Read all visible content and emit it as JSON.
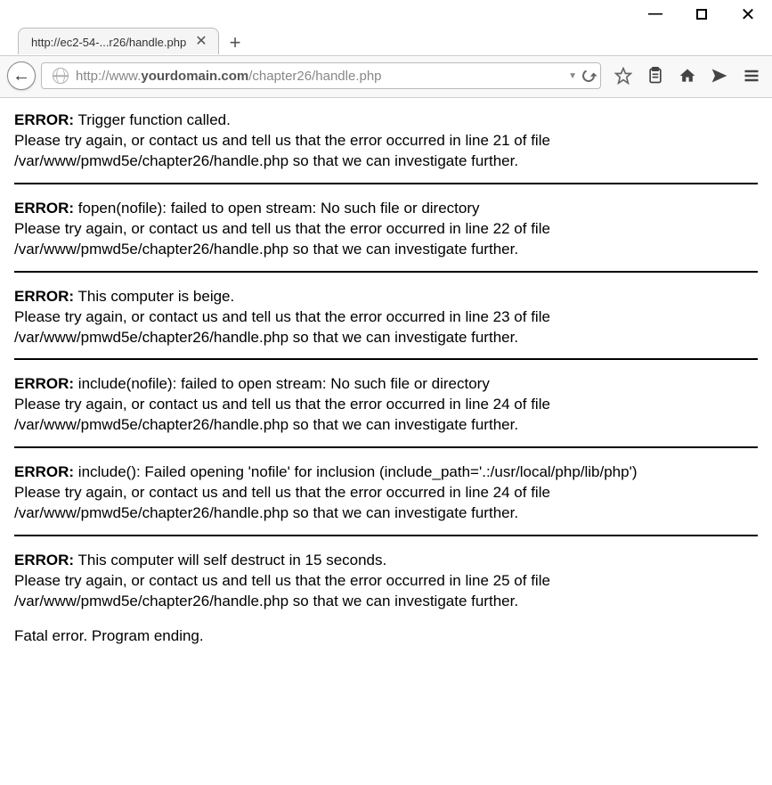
{
  "window": {
    "tab_title": "http://ec2-54-...r26/handle.php"
  },
  "url": {
    "prefix": "http://www.",
    "domain": "yourdomain.com",
    "path": "/chapter26/handle.php"
  },
  "errors": [
    {
      "label": "ERROR:",
      "message": "Trigger function called.",
      "detail": "Please try again, or contact us and tell us that the error occurred in line 21 of file /var/www/pmwd5e/chapter26/handle.php so that we can investigate further.",
      "hr": true
    },
    {
      "label": "ERROR:",
      "message": "fopen(nofile): failed to open stream: No such file or directory",
      "detail": "Please try again, or contact us and tell us that the error occurred in line 22 of file /var/www/pmwd5e/chapter26/handle.php so that we can investigate further.",
      "hr": true
    },
    {
      "label": "ERROR:",
      "message": "This computer is beige.",
      "detail": "Please try again, or contact us and tell us that the error occurred in line 23 of file /var/www/pmwd5e/chapter26/handle.php so that we can investigate further.",
      "hr": true
    },
    {
      "label": "ERROR:",
      "message": "include(nofile): failed to open stream: No such file or directory",
      "detail": "Please try again, or contact us and tell us that the error occurred in line 24 of file /var/www/pmwd5e/chapter26/handle.php so that we can investigate further.",
      "hr": true
    },
    {
      "label": "ERROR:",
      "message": "include(): Failed opening 'nofile' for inclusion (include_path='.:/usr/local/php/lib/php')",
      "detail": "Please try again, or contact us and tell us that the error occurred in line 24 of file /var/www/pmwd5e/chapter26/handle.php so that we can investigate further.",
      "hr": true
    },
    {
      "label": "ERROR:",
      "message": "This computer will self destruct in 15 seconds.",
      "detail": "Please try again, or contact us and tell us that the error occurred in line 25 of file /var/www/pmwd5e/chapter26/handle.php so that we can investigate further.",
      "hr": false
    }
  ],
  "fatal": "Fatal error. Program ending."
}
